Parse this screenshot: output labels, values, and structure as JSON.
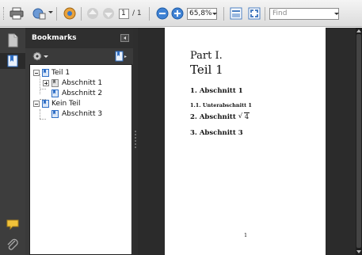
{
  "toolbar": {
    "buttons": [
      "print-icon",
      "share-icon",
      "tools-icon",
      "previous-page-icon",
      "next-page-icon",
      "zoom-out-icon",
      "zoom-in-icon",
      "fit-page-icon",
      "full-screen-icon"
    ],
    "page_current": "1",
    "page_total": "/ 1",
    "zoom": "65,8%",
    "find_placeholder": "Find"
  },
  "sidebar": {
    "panel_title": "Bookmarks",
    "tree": [
      {
        "label": "Teil 1",
        "level": 0,
        "expanded": true
      },
      {
        "label": "Abschnitt 1",
        "level": 1,
        "expanded": false
      },
      {
        "label": "Abschnitt 2",
        "level": 1
      },
      {
        "label": "Kein Teil",
        "level": 0,
        "expanded": true
      },
      {
        "label": "Abschnitt 3",
        "level": 1
      }
    ]
  },
  "document": {
    "part": "Part I.",
    "chapter": "Teil 1",
    "sections": [
      {
        "label": "1.  Abschnitt 1"
      },
      {
        "label": "1.1.  Unterabschnitt 1"
      },
      {
        "label": "2.  Abschnitt",
        "math_radicand": "4"
      },
      {
        "label": "3.  Abschnitt 3"
      }
    ],
    "page_number": "1"
  },
  "colors": {
    "accent": "#2f6fc6",
    "chrome_dark": "#3a3a3a",
    "doc_background": "#2b2b2b"
  }
}
